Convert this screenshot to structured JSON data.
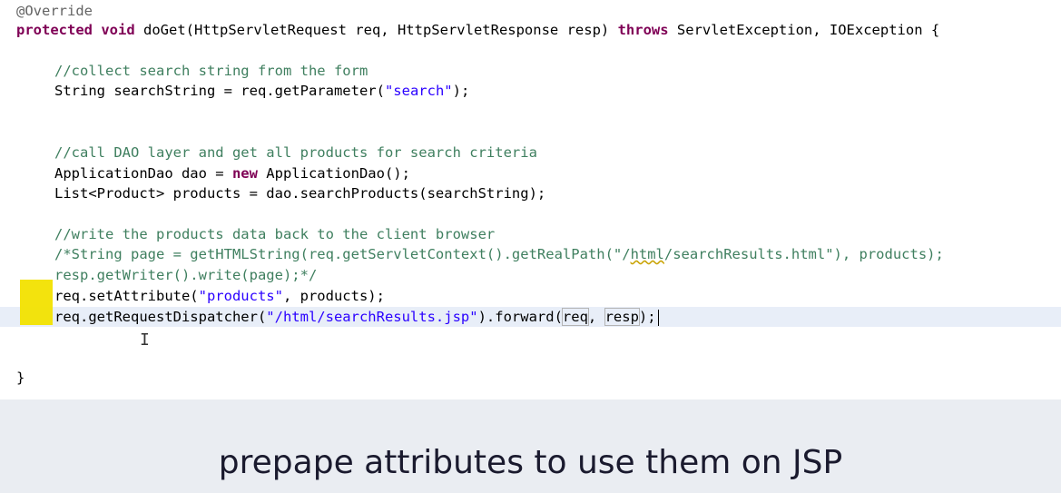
{
  "editor": {
    "l1": "@Override",
    "l2_kw1": "protected",
    "l2_kw2": "void",
    "l2_a": " doGet(HttpServletRequest req, HttpServletResponse resp) ",
    "l2_kw3": "throws",
    "l2_b": " ServletException, IOException {",
    "l3_comment": "//collect search string from the form",
    "l4_a": "String searchString = req.getParameter(",
    "l4_str": "\"search\"",
    "l4_b": ");",
    "l5_comment": "//call DAO layer and get all products for search criteria",
    "l6_a": "ApplicationDao dao = ",
    "l6_kw": "new",
    "l6_b": " ApplicationDao();",
    "l7": "List<Product> products = dao.searchProducts(searchString);",
    "l8_comment": "//write the products data back to the client browser",
    "l9_a": "/*String page = getHTMLString(req.getServletContext().getRealPath(\"/",
    "l9_sq": "html",
    "l9_b": "/searchResults.html\"), products);",
    "l10": "resp.getWriter().write(page);*/",
    "l11_a": "req.setAttribute(",
    "l11_str": "\"products\"",
    "l11_b": ", products);",
    "l12_a": "req.getRequestDispatcher(",
    "l12_str": "\"/html/searchResults.jsp\"",
    "l12_b": ").forward(",
    "l12_req": "req",
    "l12_sep": ", ",
    "l12_resp": "resp",
    "l12_c": ");",
    "l13": "}",
    "cursor_glyph": "I"
  },
  "caption": {
    "text": "prepape attributes to use them on JSP"
  },
  "colors": {
    "keyword": "#7f0055",
    "comment": "#3f7f5f",
    "string": "#2a00ff",
    "marker": "#f2e200",
    "caption_bg": "#eaedf2"
  }
}
